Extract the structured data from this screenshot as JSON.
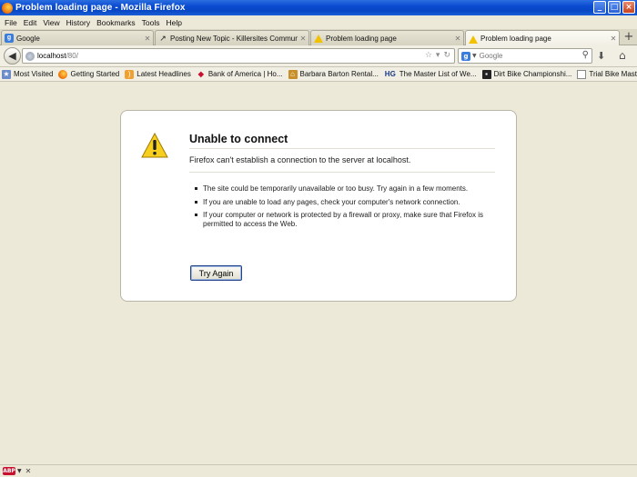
{
  "window": {
    "title": "Problem loading page - Mozilla Firefox",
    "buttons": {
      "minimize": "_",
      "maximize": "□",
      "close": "×"
    }
  },
  "menu": [
    "File",
    "Edit",
    "View",
    "History",
    "Bookmarks",
    "Tools",
    "Help"
  ],
  "tabs": [
    {
      "label": "Google",
      "icon": "google-icon",
      "active": false
    },
    {
      "label": "Posting New Topic - Killersites Community",
      "icon": "hook-icon",
      "active": false
    },
    {
      "label": "Problem loading page",
      "icon": "warning-icon",
      "active": false
    },
    {
      "label": "Problem loading page",
      "icon": "warning-icon",
      "active": true
    }
  ],
  "navbar": {
    "url_host": "localhost",
    "url_path": "/80/",
    "search_placeholder": "Google"
  },
  "bookmarks": [
    {
      "label": "Most Visited",
      "icon": "most-visited-icon"
    },
    {
      "label": "Getting Started",
      "icon": "firefox-icon"
    },
    {
      "label": "Latest Headlines",
      "icon": "rss-icon"
    },
    {
      "label": "Bank of America | Ho...",
      "icon": "bank-of-america-icon"
    },
    {
      "label": "Barbara Barton Rental...",
      "icon": "house-icon"
    },
    {
      "label": "The Master List of We...",
      "icon": "hg-icon"
    },
    {
      "label": "Dirt Bike Championshi...",
      "icon": "dirt-bike-icon"
    },
    {
      "label": "Trial Bike Master",
      "icon": "page-icon"
    }
  ],
  "error": {
    "title": "Unable to connect",
    "description": "Firefox can't establish a connection to the server at localhost.",
    "items": [
      "The site could be temporarily unavailable or too busy. Try again in a few moments.",
      "If you are unable to load any pages, check your computer's network connection.",
      "If your computer or network is protected by a firewall or proxy, make sure that Firefox is permitted to access the Web."
    ],
    "button": "Try Again"
  },
  "statusbar": {
    "addon_label": "ABP"
  },
  "colors": {
    "titlebar": "#0a4bd0",
    "content_bg": "#ece9d8",
    "warning_yellow": "#f2c200"
  }
}
